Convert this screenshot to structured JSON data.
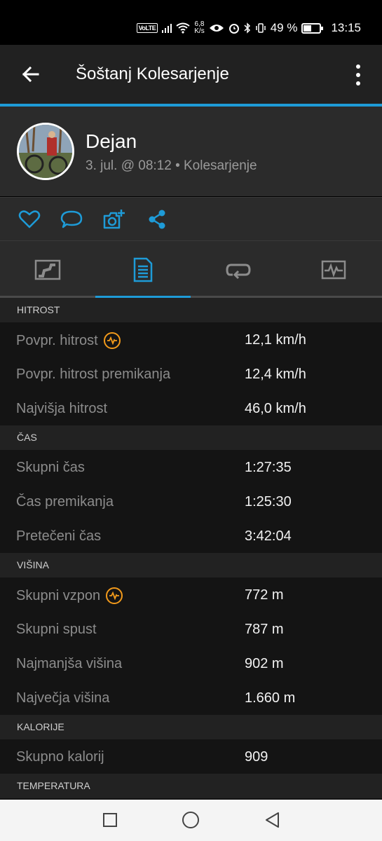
{
  "status_bar": {
    "network_badge": "VoLTE",
    "speed_value": "6,8",
    "speed_unit": "K/s",
    "battery": "49 %",
    "battery_level": 0.49,
    "time": "13:15"
  },
  "app_bar": {
    "title": "Šoštanj Kolesarjenje"
  },
  "profile": {
    "name": "Dejan",
    "meta": "3. jul. @ 08:12 • Kolesarjenje"
  },
  "icons": {
    "accent": "#1e9bd7",
    "highlight": "#f29a1b",
    "actions": [
      "heart-icon",
      "comment-icon",
      "add-photo-icon",
      "share-icon"
    ],
    "tabs": [
      "map-tab-icon",
      "details-tab-icon",
      "splits-tab-icon",
      "charts-tab-icon"
    ]
  },
  "sections": [
    {
      "header": "HITROST",
      "rows": [
        {
          "label": "Povpr. hitrost",
          "value": "12,1 km/h",
          "icon": true
        },
        {
          "label": "Povpr. hitrost premikanja",
          "value": "12,4 km/h"
        },
        {
          "label": "Najvišja hitrost",
          "value": "46,0 km/h"
        }
      ]
    },
    {
      "header": "ČAS",
      "rows": [
        {
          "label": "Skupni čas",
          "value": "1:27:35"
        },
        {
          "label": "Čas premikanja",
          "value": "1:25:30"
        },
        {
          "label": "Pretečeni čas",
          "value": "3:42:04"
        }
      ]
    },
    {
      "header": "VIŠINA",
      "rows": [
        {
          "label": "Skupni vzpon",
          "value": "772 m",
          "icon": true
        },
        {
          "label": "Skupni spust",
          "value": "787 m"
        },
        {
          "label": "Najmanjša višina",
          "value": "902 m"
        },
        {
          "label": "Največja višina",
          "value": "1.660 m"
        }
      ]
    },
    {
      "header": "KALORIJE",
      "rows": [
        {
          "label": "Skupno kalorij",
          "value": "909"
        }
      ]
    },
    {
      "header": "TEMPERATURA",
      "rows": []
    }
  ]
}
